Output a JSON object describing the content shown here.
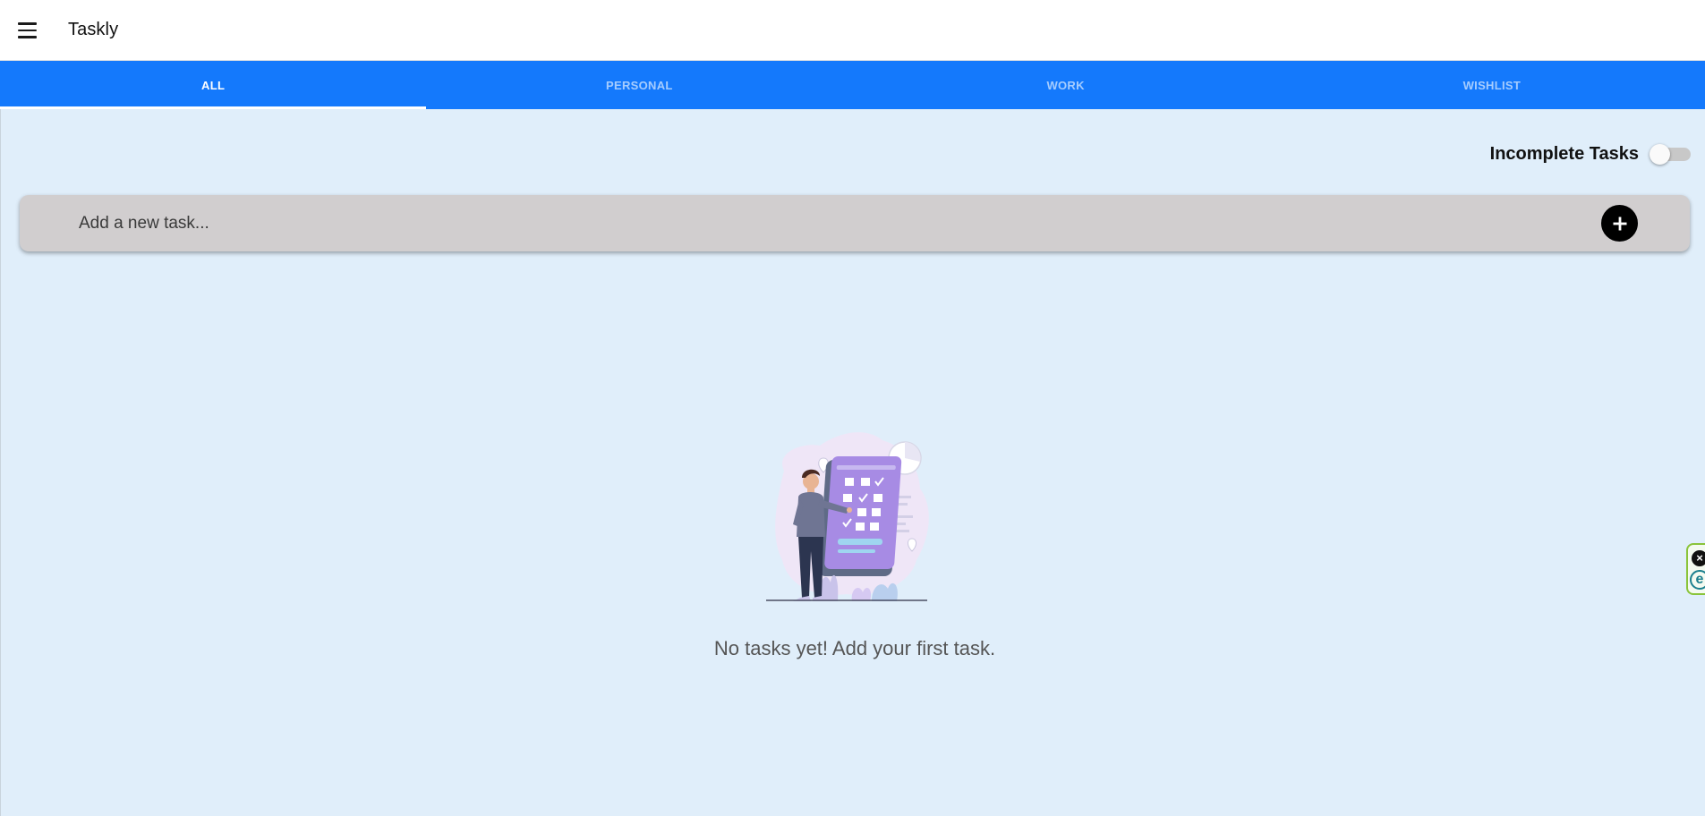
{
  "app": {
    "title": "Taskly"
  },
  "tabs": [
    {
      "label": "ALL",
      "active": true
    },
    {
      "label": "PERSONAL",
      "active": false
    },
    {
      "label": "WORK",
      "active": false
    },
    {
      "label": "WISHLIST",
      "active": false
    }
  ],
  "filter": {
    "label": "Incomplete Tasks",
    "enabled": false
  },
  "add_task": {
    "placeholder": "Add a new task...",
    "button_icon": "plus-icon"
  },
  "empty_state": {
    "message": "No tasks yet! Add your first task.",
    "illustration": "person-with-checklist-illustration"
  },
  "icons": {
    "menu": "hamburger-menu-icon"
  },
  "colors": {
    "primary": "#1479fc",
    "background": "#e0eefa",
    "input_bar": "#d1cecf"
  }
}
